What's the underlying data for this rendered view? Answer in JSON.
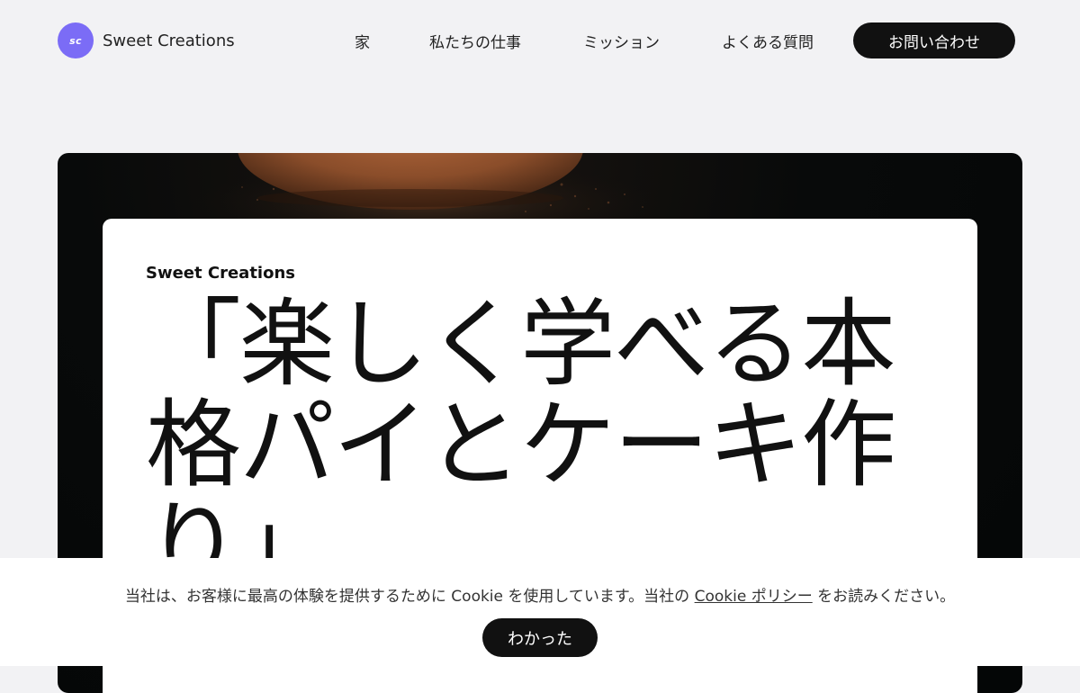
{
  "header": {
    "logo_badge": "sc",
    "brand": "Sweet Creations",
    "nav": {
      "home": "家",
      "work": "私たちの仕事",
      "mission": "ミッション",
      "faq": "よくある質問"
    },
    "contact_label": "お問い合わせ"
  },
  "hero": {
    "brand": "Sweet Creations",
    "title": "「楽しく学べる本格パイとケーキ作り」",
    "background_image": "cocoa-dusted-pastry-icon"
  },
  "cookie_banner": {
    "text_before": "当社は、お客様に最高の体験を提供するために Cookie を使用しています。当社の ",
    "link_label": "Cookie ポリシー",
    "text_after": " をお読みください。",
    "accept_label": "わかった"
  },
  "colors": {
    "page_bg": "#f2f2f4",
    "accent": "#7b6cf6",
    "button_bg": "#111111",
    "hero_bg": "#070909"
  }
}
